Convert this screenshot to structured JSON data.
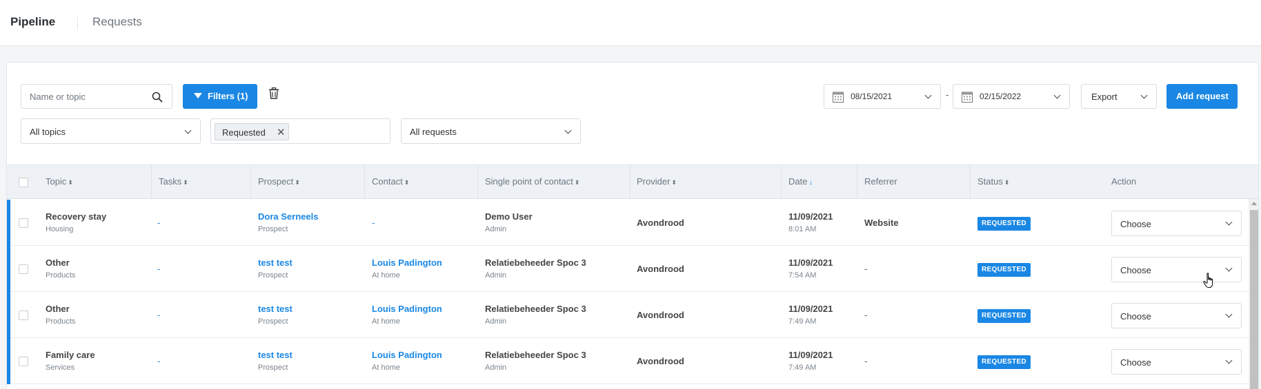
{
  "header": {
    "title": "Pipeline",
    "breadcrumb": "Requests"
  },
  "toolbar": {
    "search_placeholder": "Name or topic",
    "filters_label": "Filters (1)",
    "date_from": "08/15/2021",
    "date_separator": "-",
    "date_to": "02/15/2022",
    "export_label": "Export",
    "add_request_label": "Add request"
  },
  "filters": {
    "topics_value": "All topics",
    "status_tag": "Requested",
    "status_tag_remove": "✕",
    "requests_value": "All requests"
  },
  "table": {
    "headers": {
      "topic": "Topic",
      "tasks": "Tasks",
      "prospect": "Prospect",
      "contact": "Contact",
      "spoc": "Single point of contact",
      "provider": "Provider",
      "date": "Date",
      "referrer": "Referrer",
      "status": "Status",
      "action": "Action"
    },
    "sort_icon": "⬍",
    "sort_active_icon": "↓",
    "rows": [
      {
        "topic": "Recovery stay",
        "topic_sub": "Housing",
        "tasks": "-",
        "prospect": "Dora Serneels",
        "prospect_sub": "Prospect",
        "contact": "-",
        "contact_sub": "",
        "spoc": "Demo User",
        "spoc_sub": "Admin",
        "provider": "Avondrood",
        "date": "11/09/2021",
        "time": "8:01 AM",
        "referrer": "Website",
        "status": "REQUESTED",
        "action": "Choose"
      },
      {
        "topic": "Other",
        "topic_sub": "Products",
        "tasks": "-",
        "prospect": "test test",
        "prospect_sub": "Prospect",
        "contact": "Louis Padington",
        "contact_sub": "At home",
        "spoc": "Relatiebeheeder Spoc 3",
        "spoc_sub": "Admin",
        "provider": "Avondrood",
        "date": "11/09/2021",
        "time": "7:54 AM",
        "referrer": "-",
        "status": "REQUESTED",
        "action": "Choose"
      },
      {
        "topic": "Other",
        "topic_sub": "Products",
        "tasks": "-",
        "prospect": "test test",
        "prospect_sub": "Prospect",
        "contact": "Louis Padington",
        "contact_sub": "At home",
        "spoc": "Relatiebeheeder Spoc 3",
        "spoc_sub": "Admin",
        "provider": "Avondrood",
        "date": "11/09/2021",
        "time": "7:49 AM",
        "referrer": "-",
        "status": "REQUESTED",
        "action": "Choose"
      },
      {
        "topic": "Family care",
        "topic_sub": "Services",
        "tasks": "-",
        "prospect": "test test",
        "prospect_sub": "Prospect",
        "contact": "Louis Padington",
        "contact_sub": "At home",
        "spoc": "Relatiebeheeder Spoc 3",
        "spoc_sub": "Admin",
        "provider": "Avondrood",
        "date": "11/09/2021",
        "time": "7:49 AM",
        "referrer": "-",
        "status": "REQUESTED",
        "action": "Choose"
      }
    ]
  },
  "colors": {
    "primary": "#1a87e4",
    "header_bg": "#eef2f6"
  }
}
